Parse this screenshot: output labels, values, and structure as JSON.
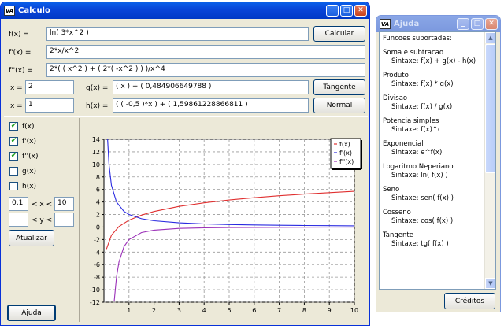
{
  "calc_window": {
    "title": "Calculo",
    "icon_text": "VA",
    "minimize": "_",
    "maximize": "□",
    "close": "✕"
  },
  "inputs": {
    "f_label": "f(x) =",
    "f_value": "ln( 3*x^2 )",
    "fp_label": "f'(x) =",
    "fp_value": "2*x/x^2",
    "fpp_label": "f''(x) =",
    "fpp_value": "2*( ( x^2 ) + ( 2*( -x^2 ) ) )/x^4",
    "x1_label": "x =",
    "x1_value": "2",
    "g_label": "g(x) =",
    "g_value": "( x ) + ( 0,484906649788 )",
    "x2_label": "x =",
    "x2_value": "1",
    "h_label": "h(x) =",
    "h_value": "( ( -0,5 )*x ) + ( 1,59861228866811 )"
  },
  "buttons": {
    "calcular": "Calcular",
    "tangente": "Tangente",
    "normal": "Normal",
    "atualizar": "Atualizar",
    "ajuda": "Ajuda"
  },
  "checkboxes": [
    {
      "label": "f(x)",
      "checked": true
    },
    {
      "label": "f'(x)",
      "checked": true
    },
    {
      "label": "f''(x)",
      "checked": true
    },
    {
      "label": "g(x)",
      "checked": false
    },
    {
      "label": "h(x)",
      "checked": false
    }
  ],
  "range": {
    "x_min": "0,1",
    "x_sep": "< x <",
    "x_max": "10",
    "y_min": "",
    "y_sep": "< y <",
    "y_max": ""
  },
  "chart_data": {
    "type": "line",
    "xlim": [
      0,
      10
    ],
    "ylim": [
      -12,
      14
    ],
    "xticks": [
      "1",
      "2",
      "3",
      "4",
      "5",
      "6",
      "7",
      "8",
      "9",
      "10"
    ],
    "yticks": [
      "14",
      "12",
      "10",
      "8",
      "6",
      "4",
      "2",
      "0",
      "-2",
      "-4",
      "-6",
      "-8",
      "-10",
      "-12"
    ],
    "grid": true,
    "legend_position": "top-right",
    "series": [
      {
        "name": "f(x)",
        "color": "#e03030",
        "x": [
          0.1,
          0.3,
          0.6,
          1,
          1.5,
          2,
          3,
          4,
          5,
          6,
          7,
          8,
          9,
          10
        ],
        "y": [
          -3.51,
          -1.31,
          0.08,
          1.1,
          1.91,
          2.48,
          3.3,
          3.87,
          4.32,
          4.68,
          4.99,
          5.26,
          5.49,
          5.7
        ]
      },
      {
        "name": "f'(x)",
        "color": "#2a2ae0",
        "x": [
          0.14,
          0.2,
          0.3,
          0.5,
          0.8,
          1,
          1.5,
          2,
          3,
          4,
          5,
          6,
          7,
          8,
          9,
          10
        ],
        "y": [
          14.3,
          10,
          6.67,
          4,
          2.5,
          2,
          1.33,
          1,
          0.67,
          0.5,
          0.4,
          0.33,
          0.29,
          0.25,
          0.22,
          0.2
        ]
      },
      {
        "name": "f''(x)",
        "color": "#9b30b8",
        "x": [
          0.41,
          0.5,
          0.6,
          0.8,
          1,
          1.5,
          2,
          3,
          4,
          5,
          6,
          7,
          8,
          9,
          10
        ],
        "y": [
          -11.9,
          -8,
          -5.56,
          -3.13,
          -2,
          -0.89,
          -0.5,
          -0.22,
          -0.13,
          -0.08,
          -0.06,
          -0.04,
          -0.03,
          -0.02,
          -0.02
        ]
      }
    ]
  },
  "help_window": {
    "title": "Ajuda",
    "icon_text": "VA",
    "creditos": "Créditos",
    "items": [
      {
        "text": "Funcoes suportadas:",
        "sub": false
      },
      {
        "text": "",
        "sub": false
      },
      {
        "text": "Soma e subtracao",
        "sub": false
      },
      {
        "text": "Sintaxe: f(x) + g(x) - h(x)",
        "sub": true
      },
      {
        "text": "",
        "sub": false
      },
      {
        "text": "Produto",
        "sub": false
      },
      {
        "text": "Sintaxe: f(x) * g(x)",
        "sub": true
      },
      {
        "text": "",
        "sub": false
      },
      {
        "text": "Divisao",
        "sub": false
      },
      {
        "text": "Sintaxe: f(x) / g(x)",
        "sub": true
      },
      {
        "text": "",
        "sub": false
      },
      {
        "text": "Potencia simples",
        "sub": false
      },
      {
        "text": "Sintaxe: f(x)^c",
        "sub": true
      },
      {
        "text": "",
        "sub": false
      },
      {
        "text": "Exponencial",
        "sub": false
      },
      {
        "text": "Sintaxe: e^f(x)",
        "sub": true
      },
      {
        "text": "",
        "sub": false
      },
      {
        "text": "Logaritmo Neperiano",
        "sub": false
      },
      {
        "text": "Sintaxe: ln( f(x) )",
        "sub": true
      },
      {
        "text": "",
        "sub": false
      },
      {
        "text": "Seno",
        "sub": false
      },
      {
        "text": "Sintaxe: sen( f(x) )",
        "sub": true
      },
      {
        "text": "",
        "sub": false
      },
      {
        "text": "Cosseno",
        "sub": false
      },
      {
        "text": "Sintaxe: cos( f(x) )",
        "sub": true
      },
      {
        "text": "",
        "sub": false
      },
      {
        "text": "Tangente",
        "sub": false
      },
      {
        "text": "Sintaxe: tg( f(x) )",
        "sub": true
      }
    ]
  }
}
